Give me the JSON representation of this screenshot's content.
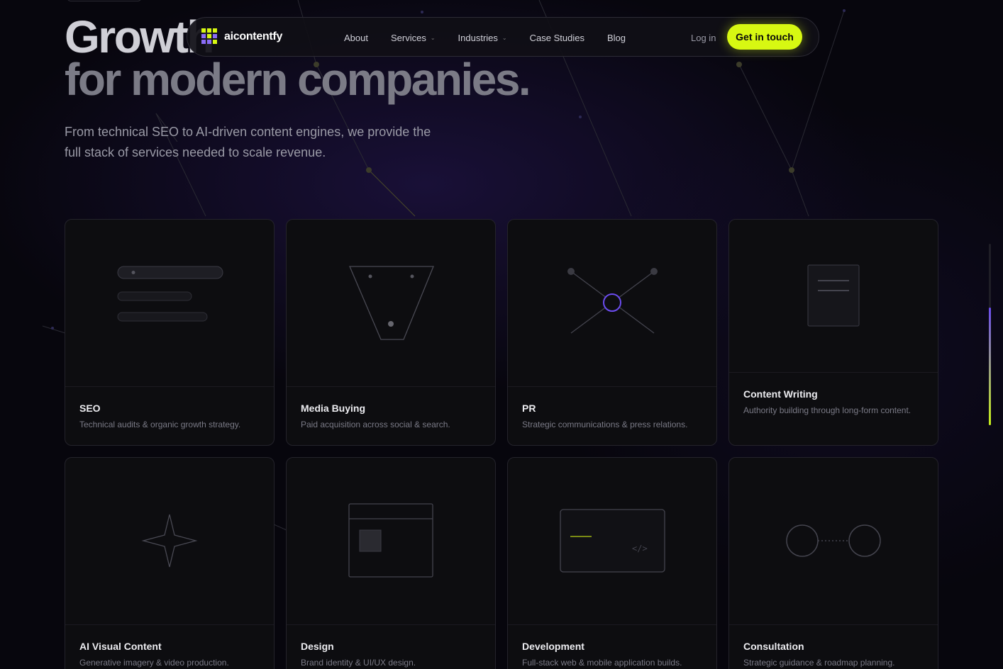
{
  "hero": {
    "headline_1": "Growth",
    "headline_2": "for modern companies.",
    "subtext": "From technical SEO to AI-driven content engines, we provide the full stack of services needed to scale revenue."
  },
  "nav": {
    "logo_text": "aicontentfy",
    "links": [
      {
        "label": "About"
      },
      {
        "label": "Services",
        "has_dropdown": true
      },
      {
        "label": "Industries",
        "has_dropdown": true
      },
      {
        "label": "Case Studies"
      },
      {
        "label": "Blog"
      }
    ],
    "login_label": "Log in",
    "cta_label": "Get in touch"
  },
  "services": [
    {
      "title": "SEO",
      "desc": "Technical audits & organic growth strategy.",
      "icon": "search-bars-icon"
    },
    {
      "title": "Media Buying",
      "desc": "Paid acquisition across social & search.",
      "icon": "funnel-icon"
    },
    {
      "title": "PR",
      "desc": "Strategic communications & press relations.",
      "icon": "network-icon"
    },
    {
      "title": "Content Writing",
      "desc": "Authority building through long-form content.",
      "icon": "document-icon"
    },
    {
      "title": "AI Visual Content",
      "desc": "Generative imagery & video production.",
      "icon": "sparkle-icon"
    },
    {
      "title": "Design",
      "desc": "Brand identity & UI/UX design.",
      "icon": "layout-icon"
    },
    {
      "title": "Development",
      "desc": "Full-stack web & mobile application builds.",
      "icon": "code-window-icon"
    },
    {
      "title": "Consultation",
      "desc": "Strategic guidance & roadmap planning.",
      "icon": "link-circles-icon"
    }
  ],
  "colors": {
    "background": "#07060d",
    "accent_lime": "#d7f812",
    "accent_purple": "#6b4cf0",
    "card_bg": "#0d0d10"
  }
}
